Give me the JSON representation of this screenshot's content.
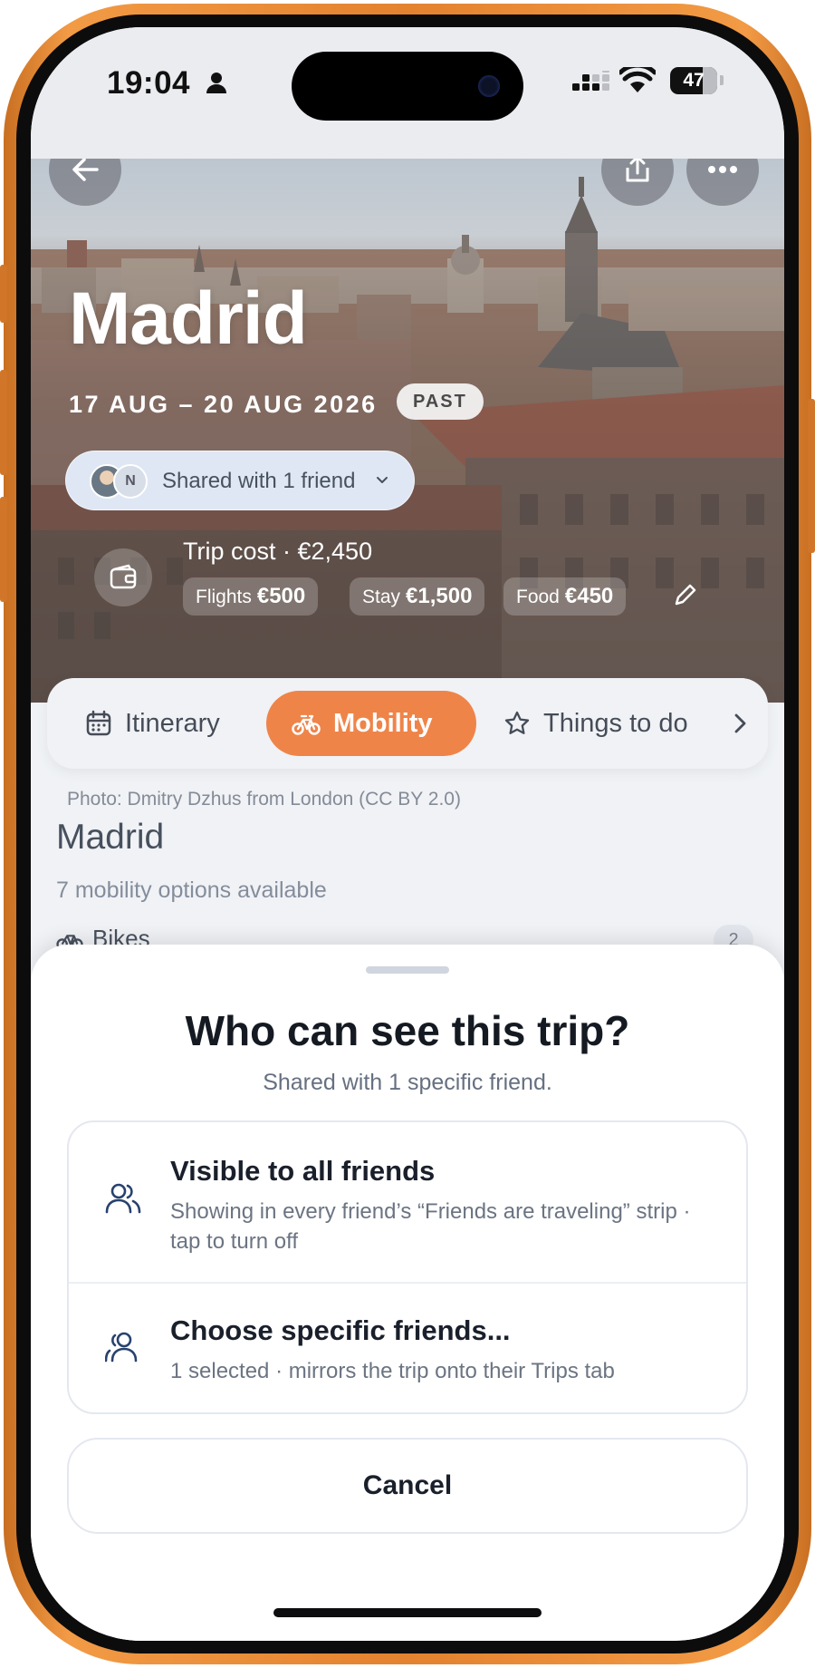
{
  "status_bar": {
    "time": "19:04",
    "battery": "47",
    "icons": [
      "person-icon",
      "signal-icon",
      "wifi-icon",
      "battery-icon"
    ]
  },
  "hero": {
    "city": "Madrid",
    "dates": "17 AUG – 20 AUG 2026",
    "badge": "PAST",
    "shared": {
      "label": "Shared with 1 friend",
      "avatar_initial": "N"
    },
    "trip_cost": {
      "label": "Trip cost · €2,450",
      "chips": [
        {
          "label": "Flights",
          "value": "€500"
        },
        {
          "label": "Stay",
          "value": "€1,500"
        },
        {
          "label": "Food",
          "value": "€450"
        }
      ]
    }
  },
  "tabs": [
    {
      "label": "Itinerary",
      "icon": "calendar-icon",
      "active": false
    },
    {
      "label": "Mobility",
      "icon": "bike-icon",
      "active": true
    },
    {
      "label": "Things to do",
      "icon": "star-icon",
      "active": false
    }
  ],
  "content": {
    "photo_credit": "Photo: Dmitry Dzhus from London (CC BY 2.0)",
    "title": "Madrid",
    "subtitle": "7 mobility options available",
    "category": {
      "label": "Bikes",
      "count": "2"
    }
  },
  "sheet": {
    "title": "Who can see this trip?",
    "subtitle": "Shared with 1 specific friend.",
    "options": [
      {
        "title": "Visible to all friends",
        "description": "Showing in every friend’s “Friends are traveling” strip · tap to turn off",
        "icon": "users-icon"
      },
      {
        "title": "Choose specific friends...",
        "description": "1 selected · mirrors the trip onto their Trips tab",
        "icon": "user-group-icon"
      }
    ],
    "cancel_label": "Cancel"
  },
  "colors": {
    "accent": "#ec6a22",
    "pill_bg": "#d8e2f2",
    "text_dark": "#151a22",
    "text_muted": "#667080"
  }
}
